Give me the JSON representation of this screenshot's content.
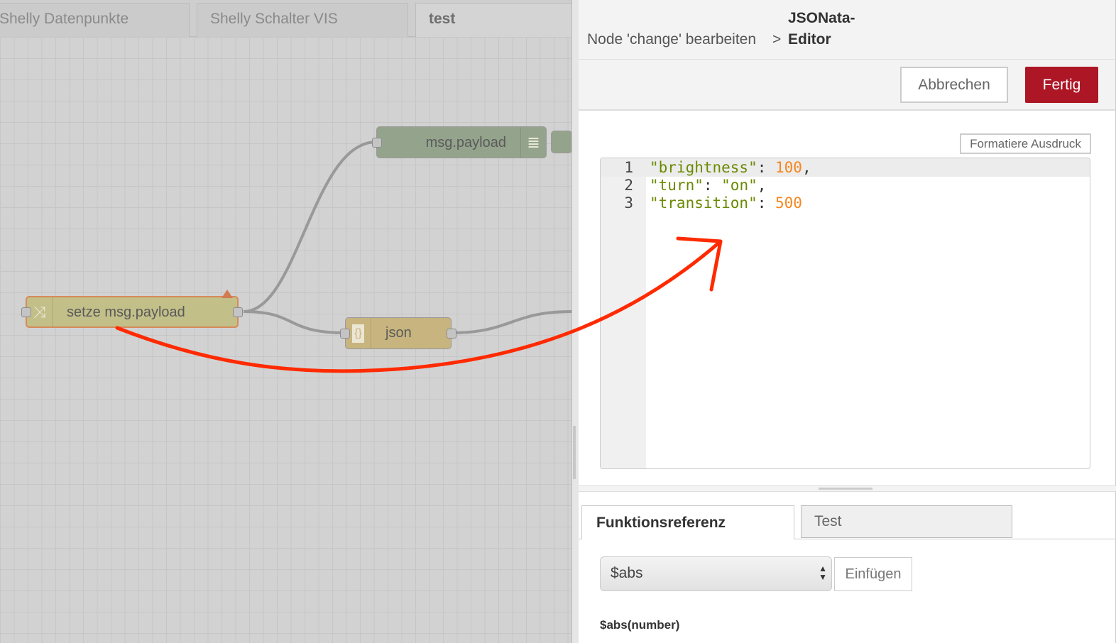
{
  "workspace": {
    "tabs": [
      "Shelly Datenpunkte",
      "Shelly Schalter VIS",
      "test"
    ],
    "nodes": {
      "change": "setze msg.payload",
      "json": "json",
      "debug": "msg.payload"
    }
  },
  "editor": {
    "breadcrumb": "Node 'change' bearbeiten",
    "separator": ">",
    "title_line1": "JSONata-",
    "title_line2": "Editor",
    "cancel": "Abbrechen",
    "done": "Fertig",
    "format": "Formatiere Ausdruck",
    "code_lines": [
      {
        "num": "1",
        "key": "\"brightness\"",
        "sep": ": ",
        "value": "100",
        "end": ","
      },
      {
        "num": "2",
        "key": "\"turn\"",
        "sep": ": ",
        "value": "\"on\"",
        "end": ","
      },
      {
        "num": "3",
        "key": "\"transition\"",
        "sep": ": ",
        "value": "500",
        "end": ""
      }
    ],
    "bottom_tabs": [
      "Funktionsreferenz",
      "Test"
    ],
    "function_select": "$abs",
    "insert": "Einfügen",
    "signature": "$abs(number)"
  },
  "colors": {
    "accent": "#ad1625",
    "annotation": "#ff2a00"
  }
}
